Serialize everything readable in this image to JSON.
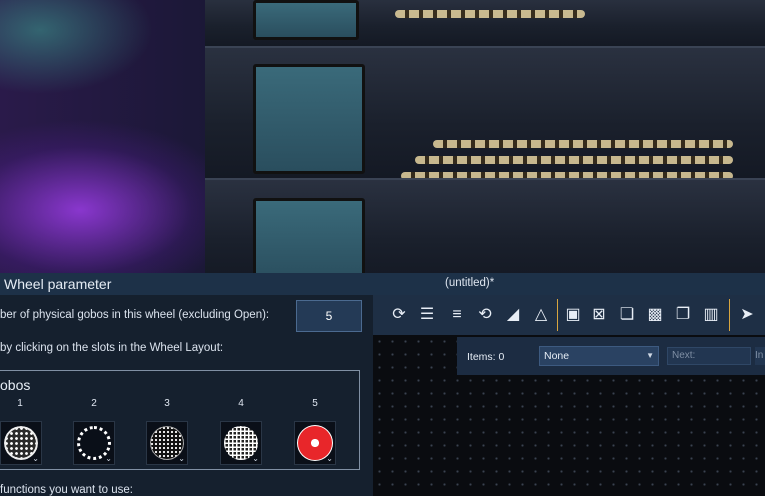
{
  "left_panel": {
    "title": "Wheel parameter",
    "gobo_count_label": "ber of physical gobos in this wheel (excluding Open):",
    "gobo_count_value": "5",
    "hint": "by clicking on the slots in the Wheel Layout:",
    "gobos_heading": "obos",
    "slots": [
      {
        "number": "1",
        "icon": "dotted-pattern-gobo-icon"
      },
      {
        "number": "2",
        "icon": "dot-ring-gobo-icon"
      },
      {
        "number": "3",
        "icon": "dot-spiral-gobo-icon"
      },
      {
        "number": "4",
        "icon": "grid-pattern-gobo-icon"
      },
      {
        "number": "5",
        "icon": "red-wheel-gobo-icon"
      }
    ],
    "footer_text": "functions you want to use:",
    "colors": {
      "slot5": "#e8262a"
    }
  },
  "right_panel": {
    "window_title": "(untitled)*",
    "items_label": "Items: 0",
    "select_value": "None",
    "next_placeholder": "Next:",
    "in_placeholder": "In"
  }
}
